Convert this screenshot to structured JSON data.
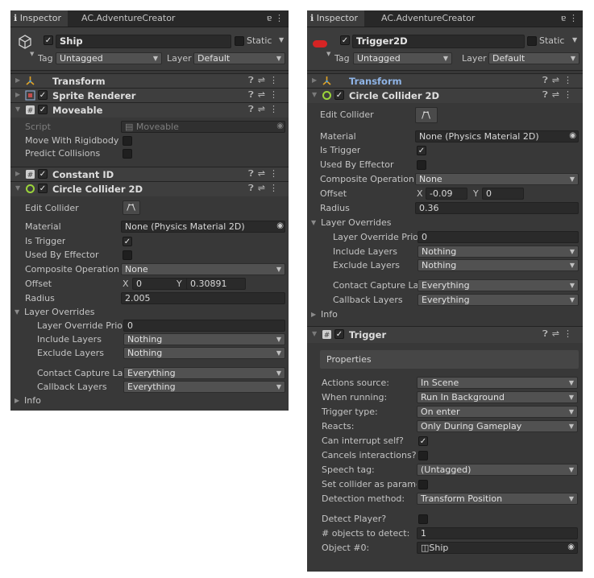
{
  "left": {
    "tab_inspector": "Inspector",
    "tab_second": "AC.AdventureCreator",
    "gameobject": {
      "name": "Ship",
      "static_label": "Static",
      "tag_label": "Tag",
      "tag_value": "Untagged",
      "layer_label": "Layer",
      "layer_value": "Default"
    },
    "components": {
      "transform": "Transform",
      "sprite_renderer": "Sprite Renderer",
      "moveable": "Moveable",
      "constant_id": "Constant ID",
      "circle_collider": "Circle Collider 2D"
    },
    "moveable": {
      "script_label": "Script",
      "script_value": "Moveable",
      "move_with_rigidbody": "Move With Rigidbody",
      "predict_collisions": "Predict Collisions"
    },
    "collider": {
      "edit_collider": "Edit Collider",
      "material_label": "Material",
      "material_value": "None (Physics Material 2D)",
      "is_trigger": "Is Trigger",
      "used_by_effector": "Used By Effector",
      "composite_operation": "Composite Operation",
      "composite_value": "None",
      "offset": "Offset",
      "offset_x_label": "X",
      "offset_x": "0",
      "offset_y_label": "Y",
      "offset_y": "0.30891",
      "radius": "Radius",
      "radius_value": "2.005",
      "layer_overrides": "Layer Overrides",
      "layer_override_priority": "Layer Override Priorit",
      "priority_value": "0",
      "include_layers": "Include Layers",
      "include_value": "Nothing",
      "exclude_layers": "Exclude Layers",
      "exclude_value": "Nothing",
      "contact_capture": "Contact Capture Laye",
      "contact_value": "Everything",
      "callback_layers": "Callback Layers",
      "callback_value": "Everything",
      "info": "Info"
    }
  },
  "right": {
    "tab_inspector": "Inspector",
    "tab_second": "AC.AdventureCreator",
    "gameobject": {
      "name": "Trigger2D",
      "static_label": "Static",
      "tag_label": "Tag",
      "tag_value": "Untagged",
      "layer_label": "Layer",
      "layer_value": "Default"
    },
    "components": {
      "transform": "Transform",
      "circle_collider": "Circle Collider 2D",
      "trigger": "Trigger"
    },
    "collider": {
      "edit_collider": "Edit Collider",
      "material_label": "Material",
      "material_value": "None (Physics Material 2D)",
      "is_trigger": "Is Trigger",
      "used_by_effector": "Used By Effector",
      "composite_operation": "Composite Operation",
      "composite_value": "None",
      "offset": "Offset",
      "offset_x_label": "X",
      "offset_x": "-0.09",
      "offset_y_label": "Y",
      "offset_y": "0",
      "radius": "Radius",
      "radius_value": "0.36",
      "layer_overrides": "Layer Overrides",
      "layer_override_priority": "Layer Override Priori",
      "priority_value": "0",
      "include_layers": "Include Layers",
      "include_value": "Nothing",
      "exclude_layers": "Exclude Layers",
      "exclude_value": "Nothing",
      "contact_capture": "Contact Capture Lay",
      "contact_value": "Everything",
      "callback_layers": "Callback Layers",
      "callback_value": "Everything",
      "info": "Info"
    },
    "trigger": {
      "properties": "Properties",
      "actions_source": "Actions source:",
      "actions_source_value": "In Scene",
      "when_running": "When running:",
      "when_running_value": "Run In Background",
      "trigger_type": "Trigger type:",
      "trigger_type_value": "On enter",
      "reacts": "Reacts:",
      "reacts_value": "Only During Gameplay",
      "can_interrupt": "Can interrupt self?",
      "cancels_interactions": "Cancels interactions?",
      "speech_tag": "Speech tag:",
      "speech_tag_value": "(Untagged)",
      "set_collider": "Set collider as paramet",
      "detection_method": "Detection method:",
      "detection_value": "Transform Position",
      "detect_player": "Detect Player?",
      "objects_to_detect": "# objects to detect:",
      "objects_value": "1",
      "object_0": "Object #0:",
      "object_0_value": "Ship"
    }
  },
  "icons": {
    "info": "info-circle-icon",
    "lock": "lock-icon",
    "menu": "kebab-menu-icon",
    "help": "help-icon",
    "preset": "preset-icon",
    "fold": "foldout-arrow-icon"
  },
  "colors": {
    "panel": "#383838",
    "header": "#3e3e3e",
    "field": "#2a2a2a",
    "dropdown": "#515151",
    "transform_link": "#8fb4e6",
    "sprite_red": "#d62424",
    "collider_green": "#9bd43a"
  }
}
